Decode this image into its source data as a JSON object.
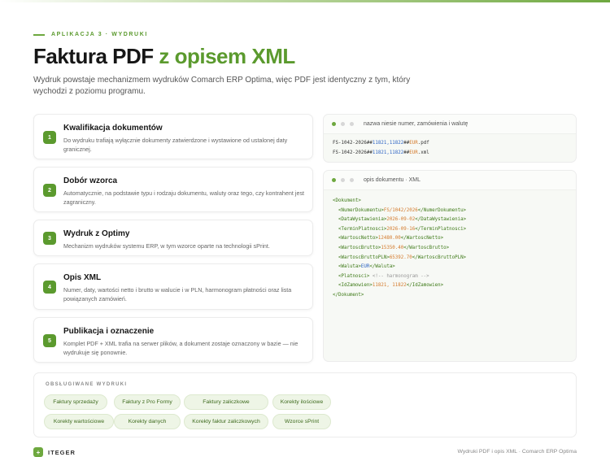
{
  "header": {
    "eyebrow": "APLIKACJA 3 · WYDRUKI",
    "title_dark": "Faktura PDF",
    "title_green": "z opisem XML",
    "lead": "Wydruk powstaje mechanizmem wydruków Comarch ERP Optima, więc PDF jest identyczny z tym, który wychodzi z poziomu programu."
  },
  "steps": [
    {
      "num": "1",
      "title": "Kwalifikacja dokumentów",
      "desc": "Do wydruku trafiają wyłącznie dokumenty zatwierdzone i wystawione od ustalonej daty granicznej."
    },
    {
      "num": "2",
      "title": "Dobór wzorca",
      "desc": "Automatycznie, na podstawie typu i rodzaju dokumentu, waluty oraz tego, czy kontrahent jest zagraniczny."
    },
    {
      "num": "3",
      "title": "Wydruk z Optimy",
      "desc": "Mechanizm wydruków systemu ERP, w tym wzorce oparte na technologii sPrint."
    },
    {
      "num": "4",
      "title": "Opis XML",
      "desc": "Numer, daty, wartości netto i brutto w walucie i w PLN, harmonogram płatności oraz lista powiązanych zamówień."
    },
    {
      "num": "5",
      "title": "Publikacja i oznaczenie",
      "desc": "Komplet PDF + XML trafia na serwer plików, a dokument zostaje oznaczony w bazie — nie wydrukuje się ponownie."
    }
  ],
  "filename_box": {
    "title": "nazwa niesie numer, zamówienia i walutę",
    "lines": [
      {
        "prefix": "FS-1042-2026##",
        "orders": "11821,11822",
        "sep": "##",
        "cur": "EUR",
        "ext": ".pdf"
      },
      {
        "prefix": "FS-1042-2026##",
        "orders": "11821,11822",
        "sep": "##",
        "cur": "EUR",
        "ext": ".xml"
      }
    ]
  },
  "xml_box": {
    "title": "opis dokumentu · XML",
    "root_open": "<Dokument>",
    "root_close": "</Dokument>",
    "fields": [
      {
        "open": "<NumerDokumentu>",
        "value": "FS/1042/2026",
        "close": "</NumerDokumentu>"
      },
      {
        "open": "<DataWystawienia>",
        "value": "2026-09-02",
        "close": "</DataWystawienia>"
      },
      {
        "open": "<TerminPlatnosci>",
        "value": "2026-09-16",
        "close": "</TerminPlatnosci>"
      },
      {
        "open": "<WartoscNetto>",
        "value": "12480.00",
        "close": "</WartoscNetto>"
      },
      {
        "open": "<WartoscBrutto>",
        "value": "15350.40",
        "close": "</WartoscBrutto>"
      },
      {
        "open": "<WartoscBruttoPLN>",
        "value": "65392.70",
        "close": "</WartoscBruttoPLN>"
      },
      {
        "open": "<Waluta>",
        "value": "EUR",
        "close": "</Waluta>"
      },
      {
        "open": "<Platnosci>",
        "value": " <!-- harmonogram -->",
        "close": ""
      },
      {
        "open": "<IdZamowien>",
        "value": "11821, 11822",
        "close": "</IdZamowien>"
      }
    ]
  },
  "supported": {
    "label": "OBSŁUGIWANE WYDRUKI",
    "chips": [
      "Faktury sprzedaży",
      "Faktury z Pro Formy",
      "Faktury zaliczkowe",
      "Korekty ilościowe",
      "Korekty wartościowe",
      "Korekty danych",
      "Korekty faktur zaliczkowych",
      "Wzorce sPrint"
    ]
  },
  "footer": {
    "logo_mark": "+",
    "brand": "ITEGER",
    "right": "Wydruki PDF i opis XML · Comarch ERP Optima"
  },
  "colors": {
    "accent": "#5b9a2e",
    "chip_bg": "#eef5e6"
  }
}
